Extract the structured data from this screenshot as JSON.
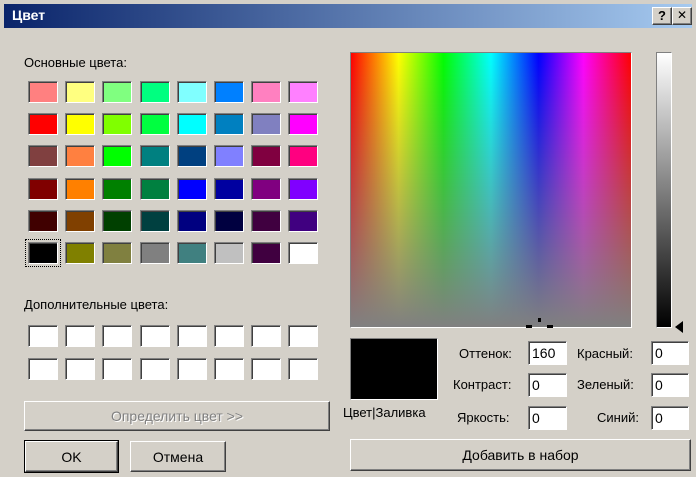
{
  "window": {
    "title": "Цвет",
    "help_label": "?",
    "close_label": "✕"
  },
  "basic_colors": {
    "label": "Основные цвета:",
    "colors": [
      [
        "#ff8080",
        "#ffff80",
        "#80ff80",
        "#00ff80",
        "#80ffff",
        "#0080ff",
        "#ff80c0",
        "#ff80ff"
      ],
      [
        "#ff0000",
        "#ffff00",
        "#80ff00",
        "#00ff40",
        "#00ffff",
        "#0080c0",
        "#8080c0",
        "#ff00ff"
      ],
      [
        "#804040",
        "#ff8040",
        "#00ff00",
        "#008080",
        "#004080",
        "#8080ff",
        "#800040",
        "#ff0080"
      ],
      [
        "#800000",
        "#ff8000",
        "#008000",
        "#008040",
        "#0000ff",
        "#0000a0",
        "#800080",
        "#8000ff"
      ],
      [
        "#400000",
        "#804000",
        "#004000",
        "#004040",
        "#000080",
        "#000040",
        "#400040",
        "#400080"
      ],
      [
        "#000000",
        "#808000",
        "#808040",
        "#808080",
        "#408080",
        "#c0c0c0",
        "#400040",
        "#ffffff"
      ]
    ],
    "selected": [
      5,
      0
    ]
  },
  "custom_colors": {
    "label": "Дополнительные цвета:",
    "colors": [
      [
        "#ffffff",
        "#ffffff",
        "#ffffff",
        "#ffffff",
        "#ffffff",
        "#ffffff",
        "#ffffff",
        "#ffffff"
      ],
      [
        "#ffffff",
        "#ffffff",
        "#ffffff",
        "#ffffff",
        "#ffffff",
        "#ffffff",
        "#ffffff",
        "#ffffff"
      ]
    ]
  },
  "define_button": "Определить цвет >>",
  "ok_button": "OK",
  "cancel_button": "Отмена",
  "preview_label": "Цвет|Заливка",
  "fields": {
    "hue": {
      "label": "Оттенок:",
      "value": "160"
    },
    "sat": {
      "label": "Контраст:",
      "value": "0"
    },
    "lum": {
      "label": "Яркость:",
      "value": "0"
    },
    "red": {
      "label": "Красный:",
      "value": "0"
    },
    "green": {
      "label": "Зеленый:",
      "value": "0"
    },
    "blue": {
      "label": "Синий:",
      "value": "0"
    }
  },
  "add_button": "Добавить в набор"
}
